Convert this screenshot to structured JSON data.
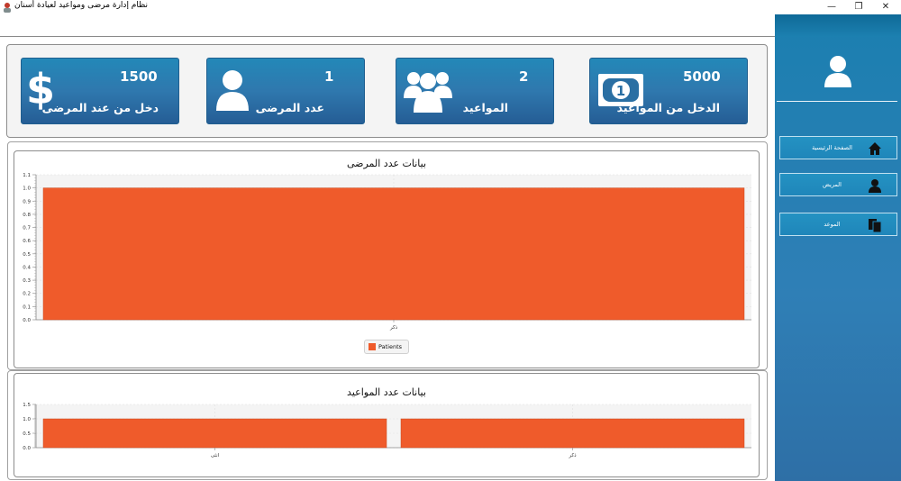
{
  "window": {
    "title": "نظام إدارة مرضى ومواعيد لعيادة أسنان",
    "controls": {
      "minimize": "—",
      "restore": "❐",
      "close": "✕"
    }
  },
  "sidebar": {
    "items": [
      {
        "label": "الصفحة الرئيسية",
        "icon": "home-icon"
      },
      {
        "label": "المريض",
        "icon": "user-icon"
      },
      {
        "label": "الموعد",
        "icon": "document-icon"
      }
    ]
  },
  "cards": [
    {
      "value": "1500",
      "label": "دخل من عند المرضى",
      "icon": "dollar-icon"
    },
    {
      "value": "1",
      "label": "عدد المرضى",
      "icon": "user-icon"
    },
    {
      "value": "2",
      "label": "المواعيد",
      "icon": "group-icon"
    },
    {
      "value": "5000",
      "label": "الدخل من المواعيد",
      "icon": "money-icon"
    }
  ],
  "chart_data": [
    {
      "type": "bar",
      "title": "بيانات عدد المرضى",
      "categories": [
        "ذكر"
      ],
      "series": [
        {
          "name": "Patients",
          "values": [
            1.0
          ]
        }
      ],
      "ylim": [
        0,
        1.1
      ],
      "yticks": [
        "0.0",
        "0.1",
        "0.2",
        "0.3",
        "0.4",
        "0.5",
        "0.6",
        "0.7",
        "0.8",
        "0.9",
        "1.0",
        "1.1"
      ],
      "legend": "bottom",
      "color": "#ef5b2b"
    },
    {
      "type": "bar",
      "title": "بيانات عدد المواعيد",
      "categories": [
        "انثى",
        "ذكر"
      ],
      "series": [
        {
          "values": [
            1.0,
            1.0
          ]
        }
      ],
      "ylim": [
        0,
        1.5
      ],
      "yticks": [
        "0.0",
        "0.5",
        "1.0",
        "1.5"
      ],
      "color": "#ef5b2b"
    }
  ]
}
